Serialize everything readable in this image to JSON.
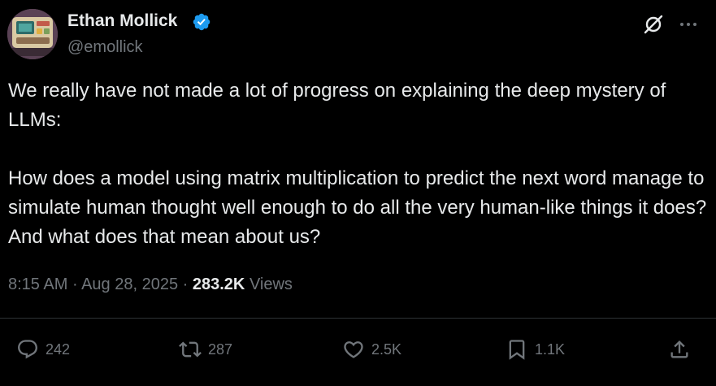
{
  "author": {
    "name": "Ethan Mollick",
    "handle": "@emollick",
    "verified": true
  },
  "tweet": {
    "paragraphs": [
      "We really have not made a lot of progress on explaining the deep mystery of LLMs:",
      "How does a model using matrix multiplication to predict the next word manage to simulate human thought well enough to do all the very human-like things it does? And what does that mean about us?"
    ]
  },
  "meta": {
    "time": "8:15 AM",
    "separator": "·",
    "date": "Aug 28, 2025",
    "views_count": "283.2K",
    "views_label": "Views"
  },
  "actions": {
    "replies": "242",
    "reposts": "287",
    "likes": "2.5K",
    "bookmarks": "1.1K"
  },
  "icons": {
    "grok": "grok-icon",
    "more": "more-icon",
    "reply": "reply-icon",
    "repost": "repost-icon",
    "like": "heart-icon",
    "bookmark": "bookmark-icon",
    "share": "share-icon",
    "verified": "verified-badge-icon"
  },
  "colors": {
    "background": "#000000",
    "text": "#e7e9ea",
    "secondary": "#71767b",
    "verified": "#1d9bf0",
    "divider": "#2f3336"
  }
}
